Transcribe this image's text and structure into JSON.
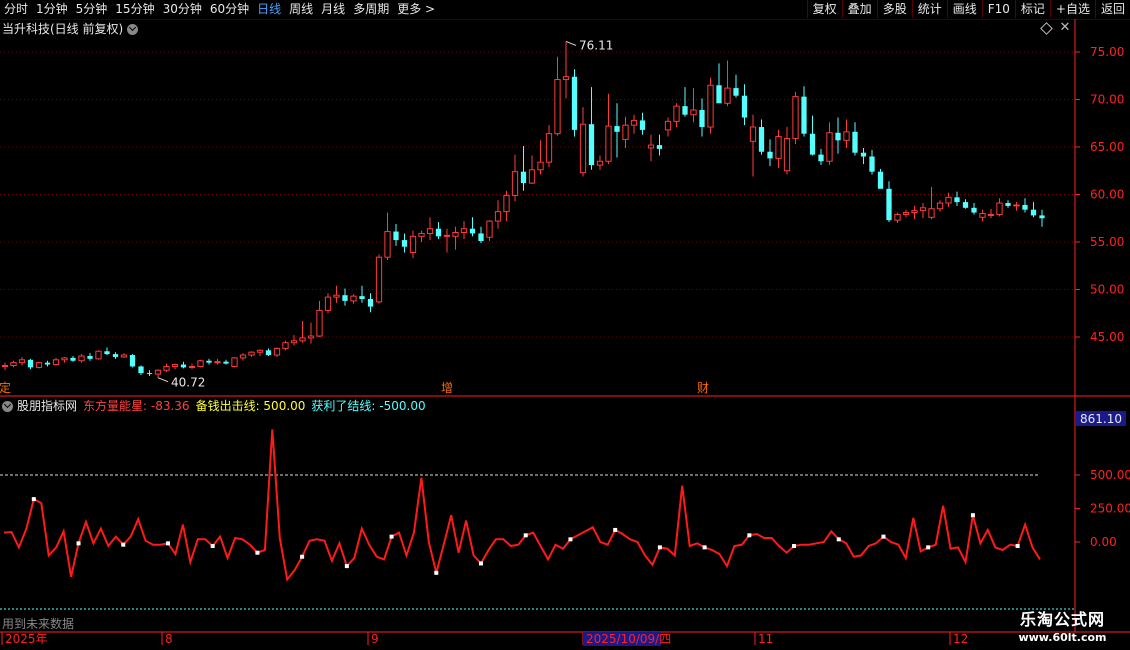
{
  "toolbar": {
    "periods": [
      "分时",
      "1分钟",
      "5分钟",
      "15分钟",
      "30分钟",
      "60分钟",
      "日线",
      "周线",
      "月线",
      "多周期",
      "更多 >"
    ],
    "active_index": 6,
    "buttons": [
      "复权",
      "叠加",
      "多股",
      "统计",
      "画线",
      "F10",
      "标记",
      "+自选",
      "返回"
    ]
  },
  "main_chart": {
    "title": "当升科技(日线 前复权)",
    "y_ticks": [
      "75.00",
      "70.00",
      "65.00",
      "60.00",
      "55.00",
      "50.00",
      "45.00"
    ],
    "y_values": [
      75,
      70,
      65,
      60,
      55,
      50,
      45
    ],
    "max_label": "76.11",
    "min_label": "40.72",
    "markers": [
      {
        "text": "定",
        "color": "#ff6a00"
      },
      {
        "text": "增",
        "color": "#ff6a00"
      },
      {
        "text": "财",
        "color": "#ff6a00"
      }
    ],
    "up_color": "#ff3a3a",
    "down_color": "#54ffff"
  },
  "indicator": {
    "name": "股朋指标网",
    "line1": "东方量能星: -83.36",
    "line2": "备钱出击线: 500.00",
    "line3": "获利了结线: -500.00",
    "y_ticks": [
      "500.00",
      "250.00",
      "0.00"
    ],
    "current_value": "861.10",
    "future_note": "用到未来数据"
  },
  "date_axis": {
    "labels": [
      "2025年",
      "8",
      "9",
      "2025/10/09/四",
      "11",
      "12"
    ]
  },
  "watermark": {
    "line1": "乐淘公式网",
    "line2": "www.60lt.com"
  },
  "chart_data": {
    "type": "candlestick",
    "ylim": [
      40.72,
      76.11
    ],
    "candles": [
      [
        41.9,
        42.3,
        41.5,
        42.0
      ],
      [
        42.0,
        42.5,
        41.8,
        42.3
      ],
      [
        42.3,
        42.9,
        42.0,
        42.6
      ],
      [
        42.6,
        42.7,
        41.6,
        41.8
      ],
      [
        41.8,
        42.4,
        41.7,
        42.3
      ],
      [
        42.3,
        42.5,
        41.9,
        42.1
      ],
      [
        42.1,
        42.8,
        42.0,
        42.6
      ],
      [
        42.6,
        42.9,
        42.3,
        42.8
      ],
      [
        42.8,
        43.0,
        42.4,
        42.5
      ],
      [
        42.5,
        43.2,
        42.3,
        43.0
      ],
      [
        43.0,
        43.3,
        42.5,
        42.7
      ],
      [
        42.7,
        43.6,
        42.6,
        43.5
      ],
      [
        43.5,
        43.9,
        43.1,
        43.2
      ],
      [
        43.2,
        43.4,
        42.7,
        42.9
      ],
      [
        42.9,
        43.3,
        42.8,
        43.1
      ],
      [
        43.1,
        43.2,
        41.8,
        41.9
      ],
      [
        41.9,
        42.0,
        41.0,
        41.2
      ],
      [
        41.2,
        41.5,
        40.9,
        41.1
      ],
      [
        41.1,
        41.6,
        40.72,
        41.5
      ],
      [
        41.5,
        42.2,
        41.3,
        41.9
      ],
      [
        41.9,
        42.2,
        41.6,
        42.1
      ],
      [
        42.1,
        42.4,
        41.7,
        41.8
      ],
      [
        41.8,
        42.2,
        41.6,
        41.9
      ],
      [
        41.9,
        42.6,
        41.8,
        42.5
      ],
      [
        42.5,
        42.7,
        42.1,
        42.3
      ],
      [
        42.3,
        42.7,
        42.1,
        42.4
      ],
      [
        42.4,
        42.6,
        42.1,
        42.2
      ],
      [
        41.9,
        42.9,
        41.8,
        42.8
      ],
      [
        42.8,
        43.3,
        42.5,
        43.1
      ],
      [
        43.1,
        43.5,
        42.9,
        43.4
      ],
      [
        43.4,
        43.7,
        43.0,
        43.6
      ],
      [
        43.6,
        43.8,
        43.0,
        43.1
      ],
      [
        43.1,
        43.9,
        42.9,
        43.8
      ],
      [
        43.8,
        44.6,
        43.6,
        44.4
      ],
      [
        44.4,
        45.2,
        44.1,
        44.6
      ],
      [
        44.6,
        46.7,
        44.4,
        44.9
      ],
      [
        44.9,
        46.5,
        44.3,
        45.1
      ],
      [
        45.1,
        48.8,
        45.0,
        47.8
      ],
      [
        47.8,
        49.6,
        47.5,
        49.2
      ],
      [
        49.2,
        50.4,
        48.6,
        49.4
      ],
      [
        49.4,
        50.1,
        48.3,
        48.8
      ],
      [
        48.8,
        49.5,
        48.5,
        49.3
      ],
      [
        49.3,
        50.4,
        48.6,
        49.0
      ],
      [
        49.0,
        49.6,
        47.6,
        48.2
      ],
      [
        48.7,
        53.7,
        48.5,
        53.4
      ],
      [
        53.4,
        58.1,
        53.1,
        56.1
      ],
      [
        56.1,
        56.9,
        54.6,
        55.2
      ],
      [
        55.2,
        55.9,
        53.9,
        54.5
      ],
      [
        53.9,
        56.2,
        53.3,
        55.6
      ],
      [
        55.6,
        56.2,
        55.0,
        55.9
      ],
      [
        55.9,
        57.6,
        55.2,
        56.4
      ],
      [
        56.4,
        57.1,
        55.3,
        55.6
      ],
      [
        55.6,
        56.4,
        53.9,
        55.7
      ],
      [
        55.6,
        56.6,
        54.2,
        56.0
      ],
      [
        56.0,
        57.2,
        55.3,
        56.4
      ],
      [
        56.4,
        57.6,
        55.6,
        55.9
      ],
      [
        55.9,
        56.6,
        54.9,
        55.1
      ],
      [
        55.5,
        57.3,
        55.1,
        57.2
      ],
      [
        57.2,
        59.4,
        56.4,
        58.2
      ],
      [
        58.2,
        60.4,
        57.2,
        59.9
      ],
      [
        59.9,
        64.2,
        59.3,
        62.4
      ],
      [
        62.4,
        65.1,
        60.4,
        61.2
      ],
      [
        61.2,
        64.1,
        61.1,
        62.6
      ],
      [
        62.6,
        65.7,
        62.1,
        63.4
      ],
      [
        63.4,
        67.3,
        62.9,
        66.4
      ],
      [
        66.4,
        74.5,
        66.2,
        72.1
      ],
      [
        72.1,
        76.11,
        70.1,
        72.4
      ],
      [
        72.4,
        73.2,
        66.1,
        66.8
      ],
      [
        62.3,
        69.2,
        61.9,
        67.4
      ],
      [
        67.4,
        71.3,
        62.6,
        63.1
      ],
      [
        63.1,
        64.1,
        62.6,
        63.5
      ],
      [
        63.5,
        70.6,
        63.2,
        67.2
      ],
      [
        67.2,
        69.6,
        63.9,
        66.6
      ],
      [
        65.8,
        68.2,
        64.9,
        67.3
      ],
      [
        67.3,
        68.4,
        66.4,
        67.8
      ],
      [
        67.8,
        68.6,
        66.3,
        66.8
      ],
      [
        64.9,
        66.3,
        63.5,
        65.2
      ],
      [
        65.2,
        66.3,
        64.1,
        64.8
      ],
      [
        66.8,
        68.1,
        66.1,
        67.7
      ],
      [
        67.7,
        69.6,
        67.1,
        69.3
      ],
      [
        69.3,
        71.3,
        68.2,
        68.4
      ],
      [
        68.4,
        71.2,
        67.6,
        68.9
      ],
      [
        68.9,
        70.1,
        66.1,
        67.1
      ],
      [
        67.1,
        72.3,
        66.4,
        71.5
      ],
      [
        71.5,
        73.8,
        69.8,
        69.6
      ],
      [
        69.6,
        74.1,
        69.3,
        71.2
      ],
      [
        71.2,
        72.6,
        70.2,
        70.4
      ],
      [
        70.4,
        71.6,
        67.3,
        68.1
      ],
      [
        65.6,
        68.4,
        61.9,
        67.1
      ],
      [
        67.1,
        67.9,
        64.2,
        64.5
      ],
      [
        64.5,
        65.8,
        63.0,
        63.8
      ],
      [
        63.8,
        66.8,
        62.8,
        66.1
      ],
      [
        62.5,
        67.1,
        62.1,
        65.9
      ],
      [
        65.9,
        70.8,
        65.3,
        70.3
      ],
      [
        70.3,
        71.4,
        66.1,
        66.4
      ],
      [
        66.4,
        68.3,
        64.1,
        64.2
      ],
      [
        64.2,
        64.8,
        63.1,
        63.5
      ],
      [
        63.5,
        67.6,
        63.1,
        66.5
      ],
      [
        66.5,
        68.1,
        64.3,
        65.7
      ],
      [
        65.7,
        67.9,
        64.9,
        66.6
      ],
      [
        66.6,
        67.6,
        64.1,
        64.4
      ],
      [
        64.4,
        64.9,
        63.2,
        64.0
      ],
      [
        64.0,
        64.7,
        62.1,
        62.4
      ],
      [
        62.4,
        62.7,
        60.8,
        60.6
      ],
      [
        60.6,
        61.4,
        57.1,
        57.3
      ],
      [
        57.3,
        58.1,
        57.0,
        57.9
      ],
      [
        57.9,
        58.4,
        57.6,
        58.1
      ],
      [
        58.1,
        58.8,
        57.4,
        58.3
      ],
      [
        58.3,
        59.1,
        57.5,
        58.6
      ],
      [
        57.6,
        60.8,
        57.4,
        58.5
      ],
      [
        58.5,
        59.4,
        58.2,
        59.1
      ],
      [
        59.1,
        60.2,
        58.7,
        59.7
      ],
      [
        59.7,
        60.3,
        58.8,
        59.2
      ],
      [
        59.2,
        59.5,
        58.5,
        58.6
      ],
      [
        58.6,
        59.1,
        57.9,
        58.1
      ],
      [
        57.6,
        58.4,
        57.2,
        58.0
      ],
      [
        57.8,
        58.5,
        57.5,
        57.9
      ],
      [
        57.9,
        59.6,
        57.7,
        59.1
      ],
      [
        59.1,
        59.4,
        58.6,
        58.8
      ],
      [
        58.8,
        59.2,
        58.3,
        58.9
      ],
      [
        58.9,
        59.6,
        58.1,
        58.4
      ],
      [
        58.4,
        59.2,
        57.6,
        57.8
      ],
      [
        57.8,
        58.4,
        56.6,
        57.5
      ]
    ],
    "indicator_values": [
      70,
      75,
      -40,
      100,
      320,
      290,
      -100,
      -40,
      80,
      -260,
      -10,
      150,
      -10,
      100,
      -30,
      40,
      -20,
      40,
      170,
      10,
      -20,
      -20,
      -10,
      -90,
      130,
      -150,
      20,
      20,
      -30,
      40,
      -120,
      30,
      20,
      -20,
      -80,
      -60,
      840,
      30,
      -280,
      -210,
      -110,
      10,
      20,
      10,
      -140,
      -10,
      -180,
      -120,
      100,
      -20,
      -110,
      -130,
      40,
      70,
      -100,
      70,
      480,
      0,
      -230,
      -20,
      200,
      -80,
      160,
      -100,
      -160,
      -60,
      20,
      20,
      -30,
      -20,
      50,
      70,
      -30,
      -130,
      -20,
      -50,
      20,
      50,
      80,
      110,
      0,
      -20,
      90,
      60,
      20,
      0,
      -100,
      -170,
      -40,
      -50,
      -100,
      420,
      -30,
      -10,
      -40,
      -60,
      -90,
      -180,
      -30,
      -20,
      50,
      60,
      30,
      30,
      -30,
      -80,
      -30,
      -20,
      -20,
      -10,
      0,
      80,
      20,
      -10,
      -110,
      -100,
      -30,
      -10,
      40,
      0,
      -20,
      -120,
      180,
      -70,
      -40,
      -20,
      270,
      -50,
      -40,
      -150,
      200,
      -10,
      90,
      -40,
      -60,
      -20,
      -30,
      130,
      -40,
      -130
    ]
  }
}
